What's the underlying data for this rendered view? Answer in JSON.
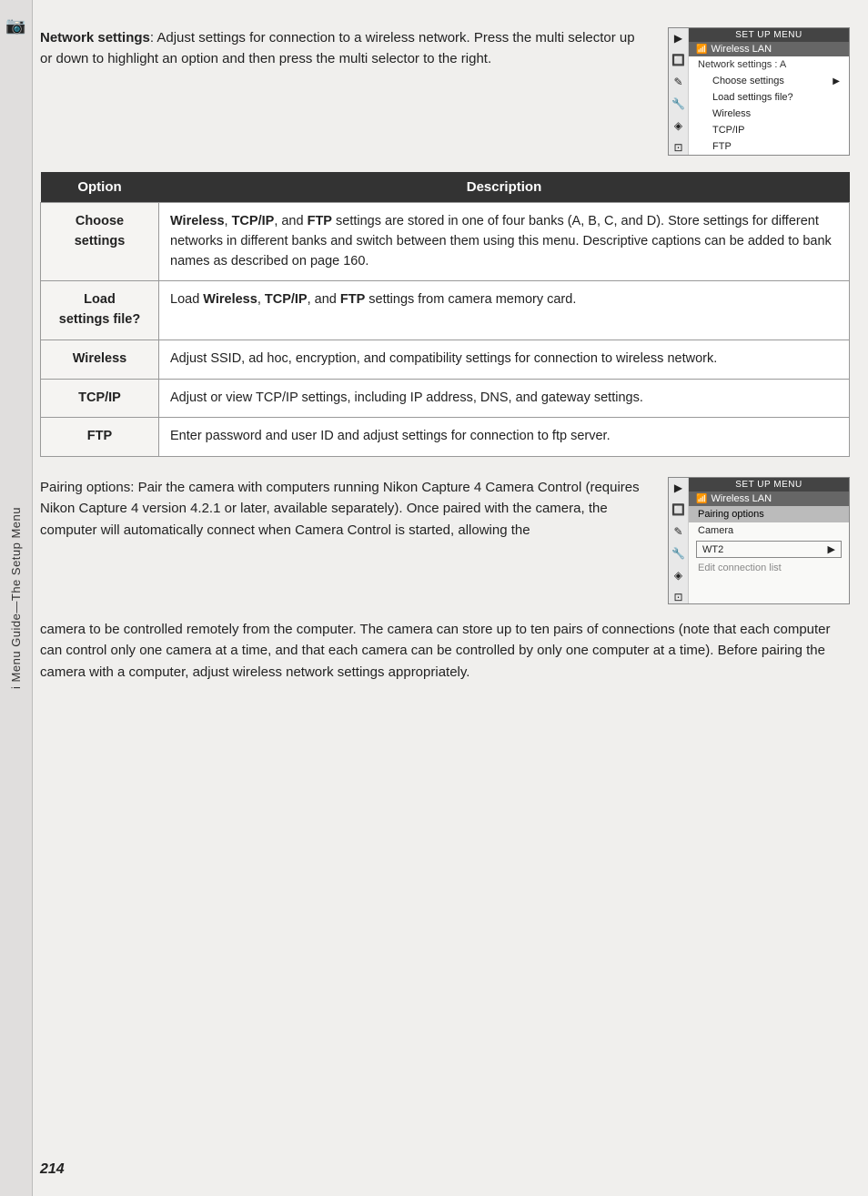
{
  "sidebar": {
    "icon": "📷",
    "label": "i Menu Guide—The Setup Menu"
  },
  "top_section": {
    "heading_bold": "Network settings",
    "heading_rest": ": Adjust settings for connection to a wireless network.  Press the multi selector up or down to highlight an option and then press the multi selector to the right."
  },
  "screenshot1": {
    "title_bar": "SET UP MENU",
    "subtitle": "Wireless LAN",
    "items": [
      {
        "label": "Network settings : A",
        "indent": false,
        "bold": false
      },
      {
        "label": "Choose settings",
        "indent": true,
        "arrow": true
      },
      {
        "label": "Load settings file?",
        "indent": true
      },
      {
        "label": "Wireless",
        "indent": true
      },
      {
        "label": "TCP/IP",
        "indent": true
      },
      {
        "label": "FTP",
        "indent": true
      }
    ]
  },
  "table": {
    "col_option": "Option",
    "col_desc": "Description",
    "rows": [
      {
        "option": "Choose settings",
        "desc_parts": [
          {
            "text": "Wireless",
            "bold": true
          },
          {
            "text": ", ",
            "bold": false
          },
          {
            "text": "TCP/IP",
            "bold": true
          },
          {
            "text": ", and ",
            "bold": false
          },
          {
            "text": "FTP",
            "bold": true
          },
          {
            "text": " settings are stored in one of four banks (A, B, C, and D).  Store settings for different networks in different banks and switch between them using this menu.  Descriptive captions can be added to bank names as described on page 160.",
            "bold": false
          }
        ]
      },
      {
        "option": "Load settings file?",
        "desc_parts": [
          {
            "text": "Load ",
            "bold": false
          },
          {
            "text": "Wireless",
            "bold": true
          },
          {
            "text": ", ",
            "bold": false
          },
          {
            "text": "TCP/IP",
            "bold": true
          },
          {
            "text": ", and ",
            "bold": false
          },
          {
            "text": "FTP",
            "bold": true
          },
          {
            "text": " settings from camera memory card.",
            "bold": false
          }
        ]
      },
      {
        "option": "Wireless",
        "desc_parts": [
          {
            "text": "Adjust SSID, ad hoc, encryption, and compatibility settings for connection to wireless network.",
            "bold": false
          }
        ]
      },
      {
        "option": "TCP/IP",
        "desc_parts": [
          {
            "text": "Adjust or view TCP/IP settings, including IP address, DNS, and gateway settings.",
            "bold": false
          }
        ]
      },
      {
        "option": "FTP",
        "desc_parts": [
          {
            "text": "Enter password and user ID and adjust settings for connection to ftp server.",
            "bold": false
          }
        ]
      }
    ]
  },
  "pairing_section": {
    "heading_bold": "Pairing options",
    "heading_rest": ": Pair the camera with computers running Nikon Capture 4 Camera Control (requires Nikon Capture 4 version 4.2.1 or later, available separately).  Once paired with the camera, the computer will automatically connect when Camera Control is started, allowing the"
  },
  "screenshot2": {
    "title_bar": "SET UP MENU",
    "subtitle": "Wireless LAN",
    "items": [
      {
        "label": "Pairing options",
        "section": true
      },
      {
        "label": "Camera",
        "indent": false
      },
      {
        "label": "WT2",
        "bordered": true,
        "arrow": true
      },
      {
        "label": "Edit connection list",
        "indent": false,
        "muted": true
      }
    ]
  },
  "continuation_text": "camera to be controlled remotely from the computer.  The camera can store up to ten pairs of connections (note that each computer can control only one camera at a time, and that each camera can be controlled by only one computer at a time).  Before pairing the camera with a computer, adjust wireless network settings appropriately.",
  "page_number": "214"
}
